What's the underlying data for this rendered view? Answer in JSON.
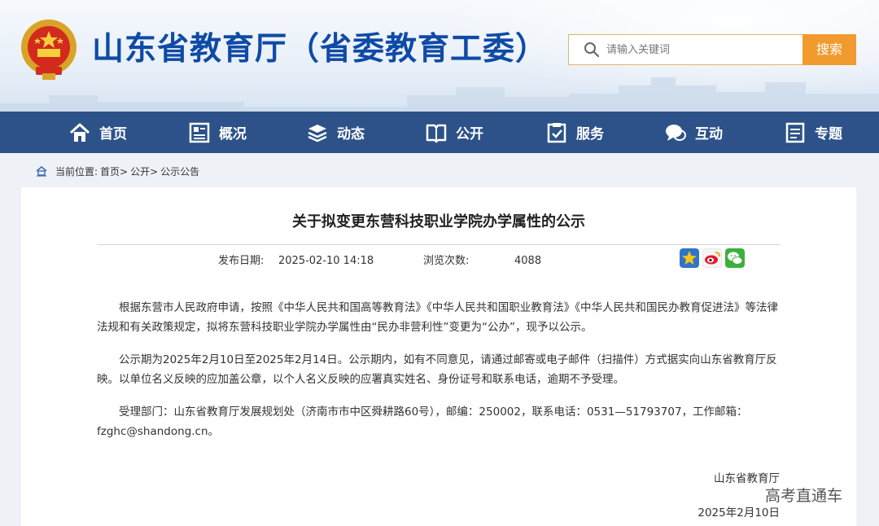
{
  "header": {
    "site_title": "山东省教育厅（省委教育工委）",
    "search_placeholder": "请输入关键词",
    "search_button": "搜索"
  },
  "nav": {
    "items": [
      {
        "label": "首页",
        "icon": "home-icon"
      },
      {
        "label": "概况",
        "icon": "overview-icon"
      },
      {
        "label": "动态",
        "icon": "news-icon"
      },
      {
        "label": "公开",
        "icon": "book-icon"
      },
      {
        "label": "服务",
        "icon": "service-icon"
      },
      {
        "label": "互动",
        "icon": "chat-icon"
      },
      {
        "label": "专题",
        "icon": "topic-icon"
      }
    ]
  },
  "breadcrumb": {
    "prefix": "当前位置:",
    "items": [
      "首页>",
      "公开>",
      "公示公告"
    ]
  },
  "article": {
    "title": "关于拟变更东营科技职业学院办学属性的公示",
    "publish_label": "发布日期:",
    "publish_date": "2025-02-10 14:18",
    "views_label": "浏览次数:",
    "views": "4088",
    "paragraphs": [
      "根据东营市人民政府申请，按照《中华人民共和国高等教育法》《中华人民共和国职业教育法》《中华人民共和国民办教育促进法》等法律法规和有关政策规定，拟将东营科技职业学院办学属性由“民办非营利性”变更为“公办”，现予以公示。",
      "公示期为2025年2月10日至2025年2月14日。公示期内，如有不同意见，请通过邮寄或电子邮件（扫描件）方式据实向山东省教育厅反映。以单位名义反映的应加盖公章，以个人名义反映的应署真实姓名、身份证号和联系电话，逾期不予受理。",
      "受理部门：山东省教育厅发展规划处（济南市市中区舜耕路60号），邮编：250002，联系电话：0531—51793707，工作邮箱：fzghc@shandong.cn。"
    ],
    "signature_org": "山东省教育厅",
    "signature_date": "2025年2月10日"
  },
  "share": {
    "icons": [
      "favorite-icon",
      "weibo-icon",
      "wechat-icon"
    ]
  },
  "watermark": "高考直通车",
  "colors": {
    "nav_bg": "#2d5289",
    "title_blue": "#0f4aa6",
    "search_orange": "#f19a2d"
  }
}
